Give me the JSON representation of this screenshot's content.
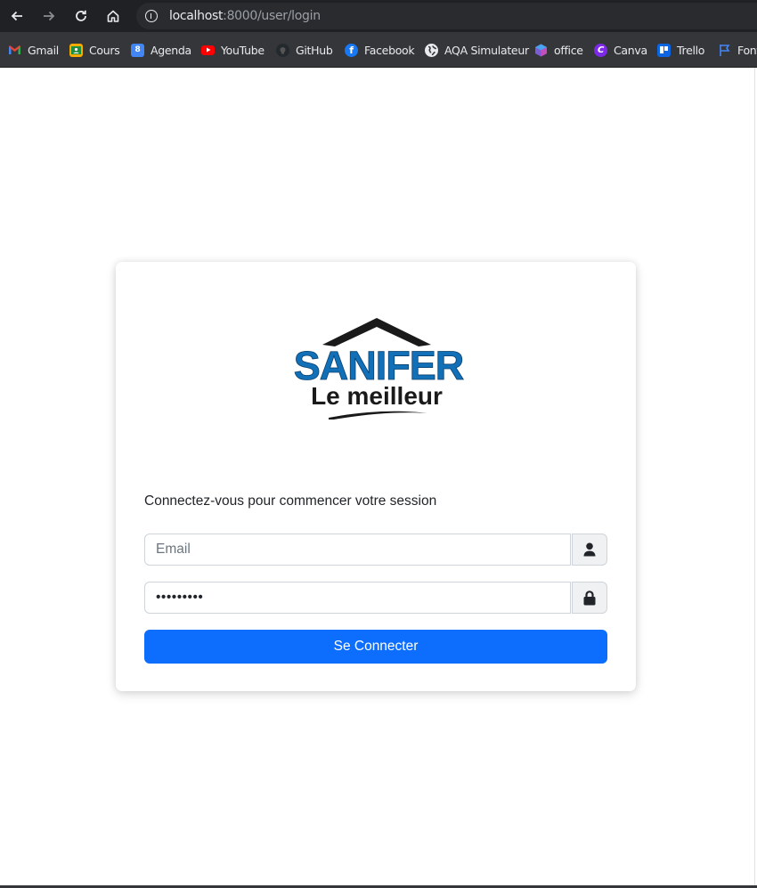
{
  "browser": {
    "url_host": "localhost",
    "url_path": ":8000/user/login",
    "bookmarks": [
      {
        "label": "Gmail",
        "icon": "gmail-icon"
      },
      {
        "label": "Cours",
        "icon": "classroom-icon"
      },
      {
        "label": "Agenda",
        "icon": "calendar-icon",
        "icon_text": "8"
      },
      {
        "label": "YouTube",
        "icon": "youtube-icon"
      },
      {
        "label": "GitHub",
        "icon": "github-icon"
      },
      {
        "label": "Facebook",
        "icon": "facebook-icon",
        "icon_text": "f"
      },
      {
        "label": "AQA Simulateur",
        "icon": "globe-icon"
      },
      {
        "label": "office",
        "icon": "office-icon"
      },
      {
        "label": "Canva",
        "icon": "canva-icon",
        "icon_text": "C"
      },
      {
        "label": "Trello",
        "icon": "trello-icon"
      },
      {
        "label": "Font",
        "icon": "flag-icon"
      }
    ]
  },
  "logo": {
    "brand": "SANIFER",
    "tagline": "Le meilleur",
    "colors": {
      "blue": "#1170b8",
      "dark": "#1a1a1a"
    }
  },
  "login": {
    "intro": "Connectez-vous pour commencer votre session",
    "email_placeholder": "Email",
    "password_value": "•••••••••",
    "submit_label": "Se Connecter"
  },
  "colors": {
    "primary": "#0d6efd",
    "chrome_dark": "#202124",
    "bookmarks_bar": "#35363a"
  }
}
